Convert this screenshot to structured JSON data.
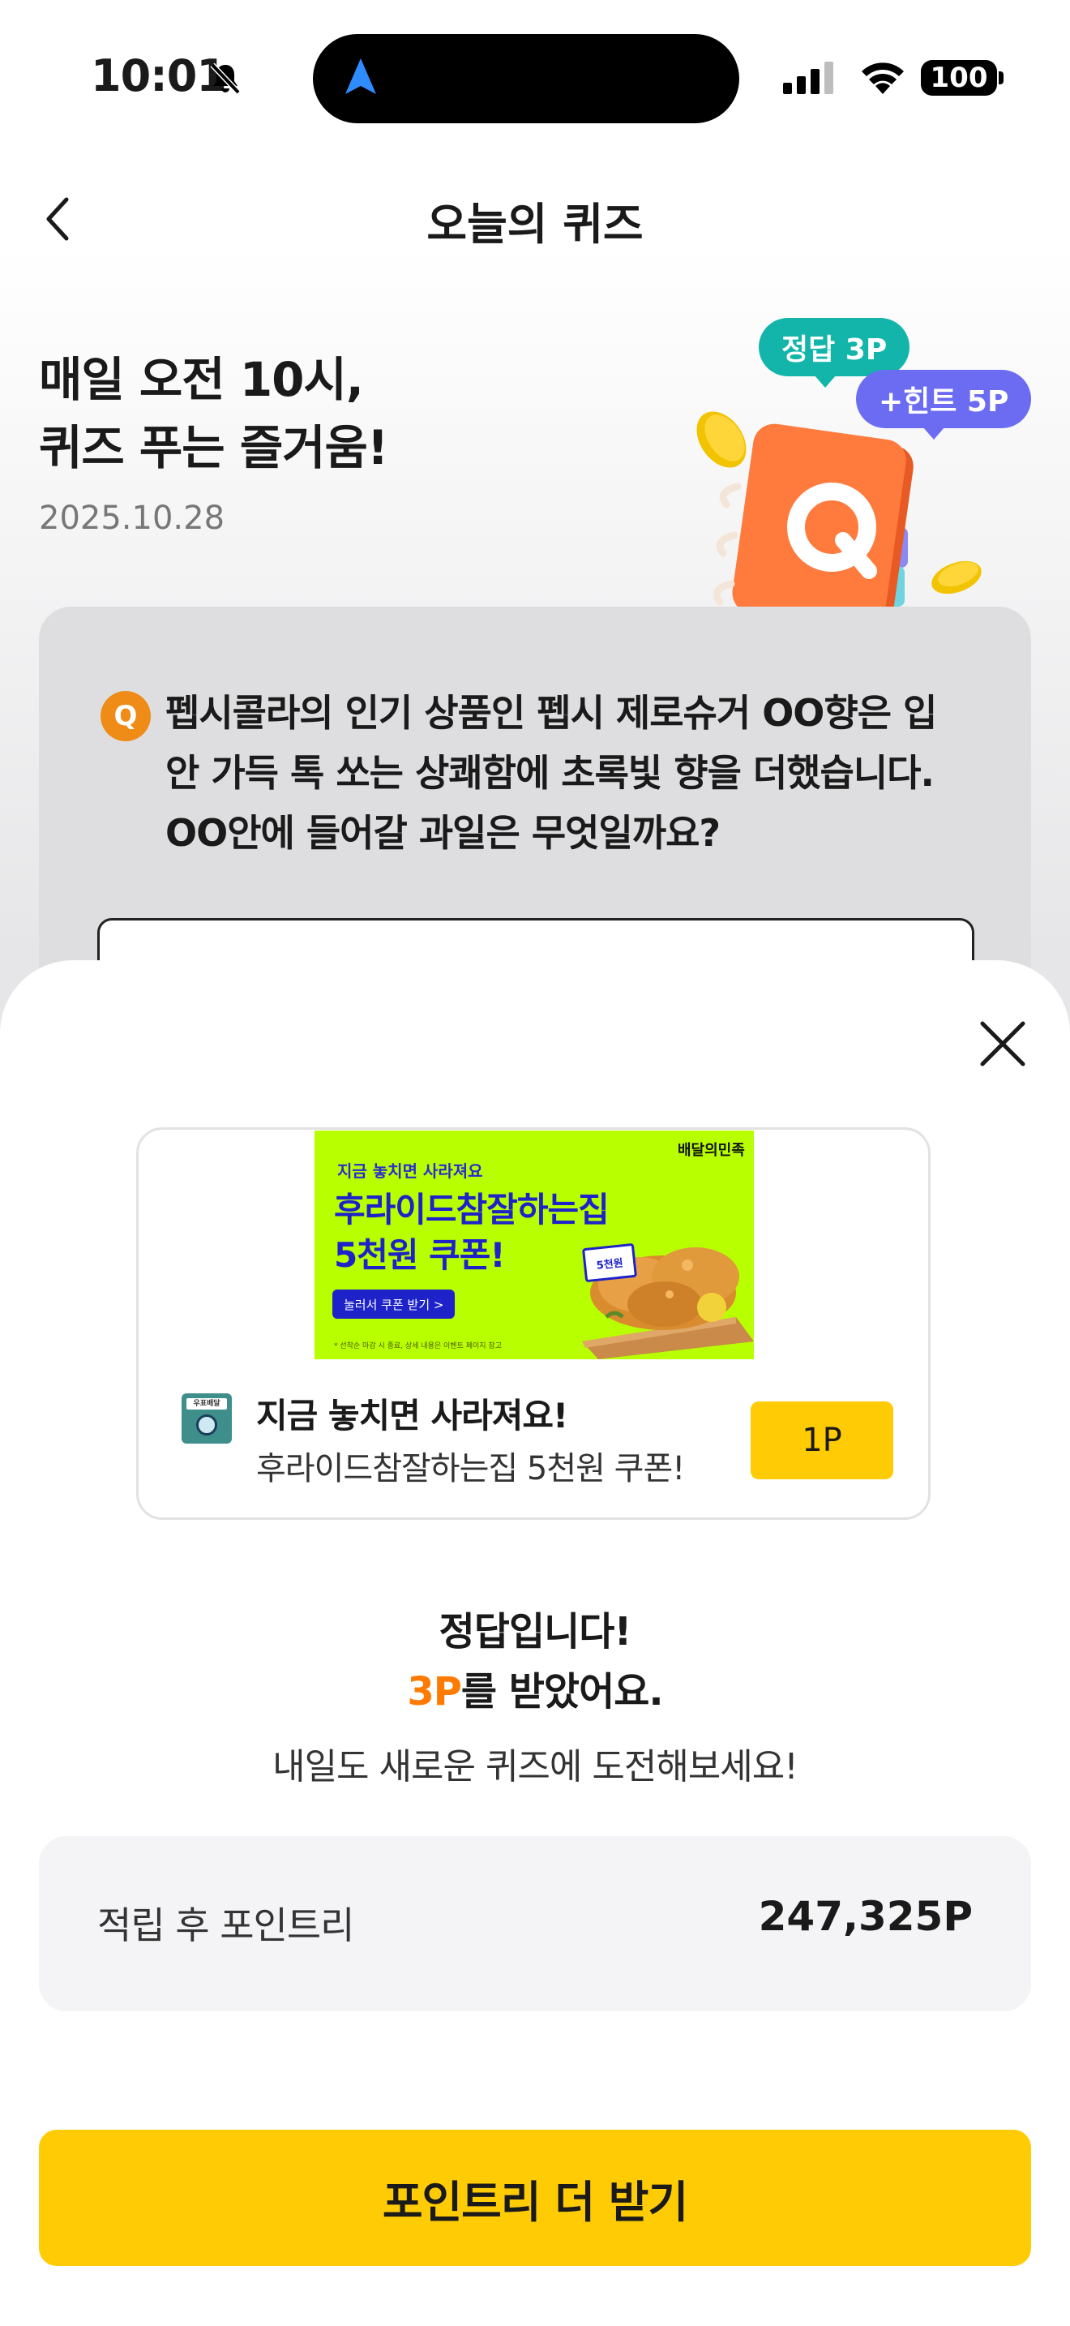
{
  "status_bar": {
    "time": "10:01",
    "battery": "100"
  },
  "header": {
    "title": "오늘의 퀴즈"
  },
  "hero": {
    "title_line1": "매일 오전 10시,",
    "title_line2": "퀴즈 푸는 즐거움!",
    "date": "2025.10.28",
    "bubble_correct": "정답 3P",
    "bubble_hint": "+힌트 5P"
  },
  "quiz": {
    "badge": "Q",
    "question_line1": "펩시콜라의 인기 상품인 펩시 제로슈거 OO향은 입",
    "question_line2": "안 가득 톡 쏘는 상쾌함에 초록빛 향을 더했습니다.",
    "question_line3": "OO안에 들어갈 과일은 무엇일까요?"
  },
  "ad": {
    "banner_brand": "배달의민족",
    "banner_small": "지금 놓치면 사라져요",
    "banner_line1": "후라이드참잘하는집",
    "banner_line2": "5천원 쿠폰!",
    "banner_button": "눌러서 쿠폰 받기 >",
    "banner_coupon": "5천원",
    "banner_fine": "* 선착순 마감 시 종료, 상세 내용은 이벤트 페이지 참고",
    "icon_label": "우표배달",
    "title": "지금 놓치면 사라져요!",
    "subtitle": "후라이드참잘하는집 5천원 쿠폰!",
    "point_button": "1P"
  },
  "result": {
    "title": "정답입니다!",
    "points": "3P",
    "points_suffix": "를 받았어요.",
    "subtitle": "내일도 새로운 퀴즈에 도전해보세요!"
  },
  "balance": {
    "label": "적립 후 포인트리",
    "value": "247,325P"
  },
  "cta": {
    "label": "포인트리 더 받기"
  },
  "colors": {
    "accent_yellow": "#ffcb05",
    "orange": "#ff7a00",
    "teal": "#13b5aa",
    "purple": "#6b6cf2",
    "ad_lime": "#b8ff00",
    "ad_blue": "#1d22c9"
  }
}
